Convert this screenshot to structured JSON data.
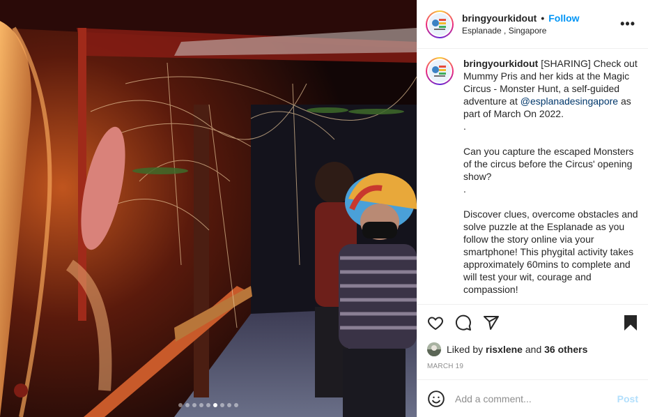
{
  "post": {
    "username": "bringyourkidout",
    "separator": "•",
    "follow_label": "Follow",
    "location": "Esplanade , Singapore",
    "more_label": "•••"
  },
  "media": {
    "image_description_icon": "photo",
    "carousel": {
      "count": 9,
      "active_index": 5
    }
  },
  "caption": {
    "username": "bringyourkidout",
    "text_1": " [SHARING] Check out Mummy Pris and her kids at the Magic Circus - Monster Hunt, a self-guided adventure at ",
    "mention": "@esplanadesingapore",
    "text_2": " as part of March On 2022.\n.\n\nCan you capture the escaped Monsters of the circus before the Circus' opening show?\n.\n\nDiscover clues, overcome obstacles and solve puzzle at the Esplanade as you follow the story online via your smartphone! This phygital activity takes approximately 60mins to complete and will test your wit, courage and compassion!"
  },
  "actions": {
    "like_icon": "heart-icon",
    "comment_icon": "comment-icon",
    "share_icon": "paper-plane-icon",
    "save_icon": "bookmark-icon"
  },
  "likes": {
    "prefix": "Liked by ",
    "user": "risxlene",
    "mid": " and ",
    "others": "36 others"
  },
  "date": "MARCH 19",
  "comment": {
    "emoji_icon": "smiley-icon",
    "placeholder": "Add a comment...",
    "post_label": "Post"
  },
  "colors": {
    "link": "#0095f6",
    "mention": "#00376b",
    "muted": "#8e8e8e",
    "post_disabled": "#b2dffc"
  }
}
